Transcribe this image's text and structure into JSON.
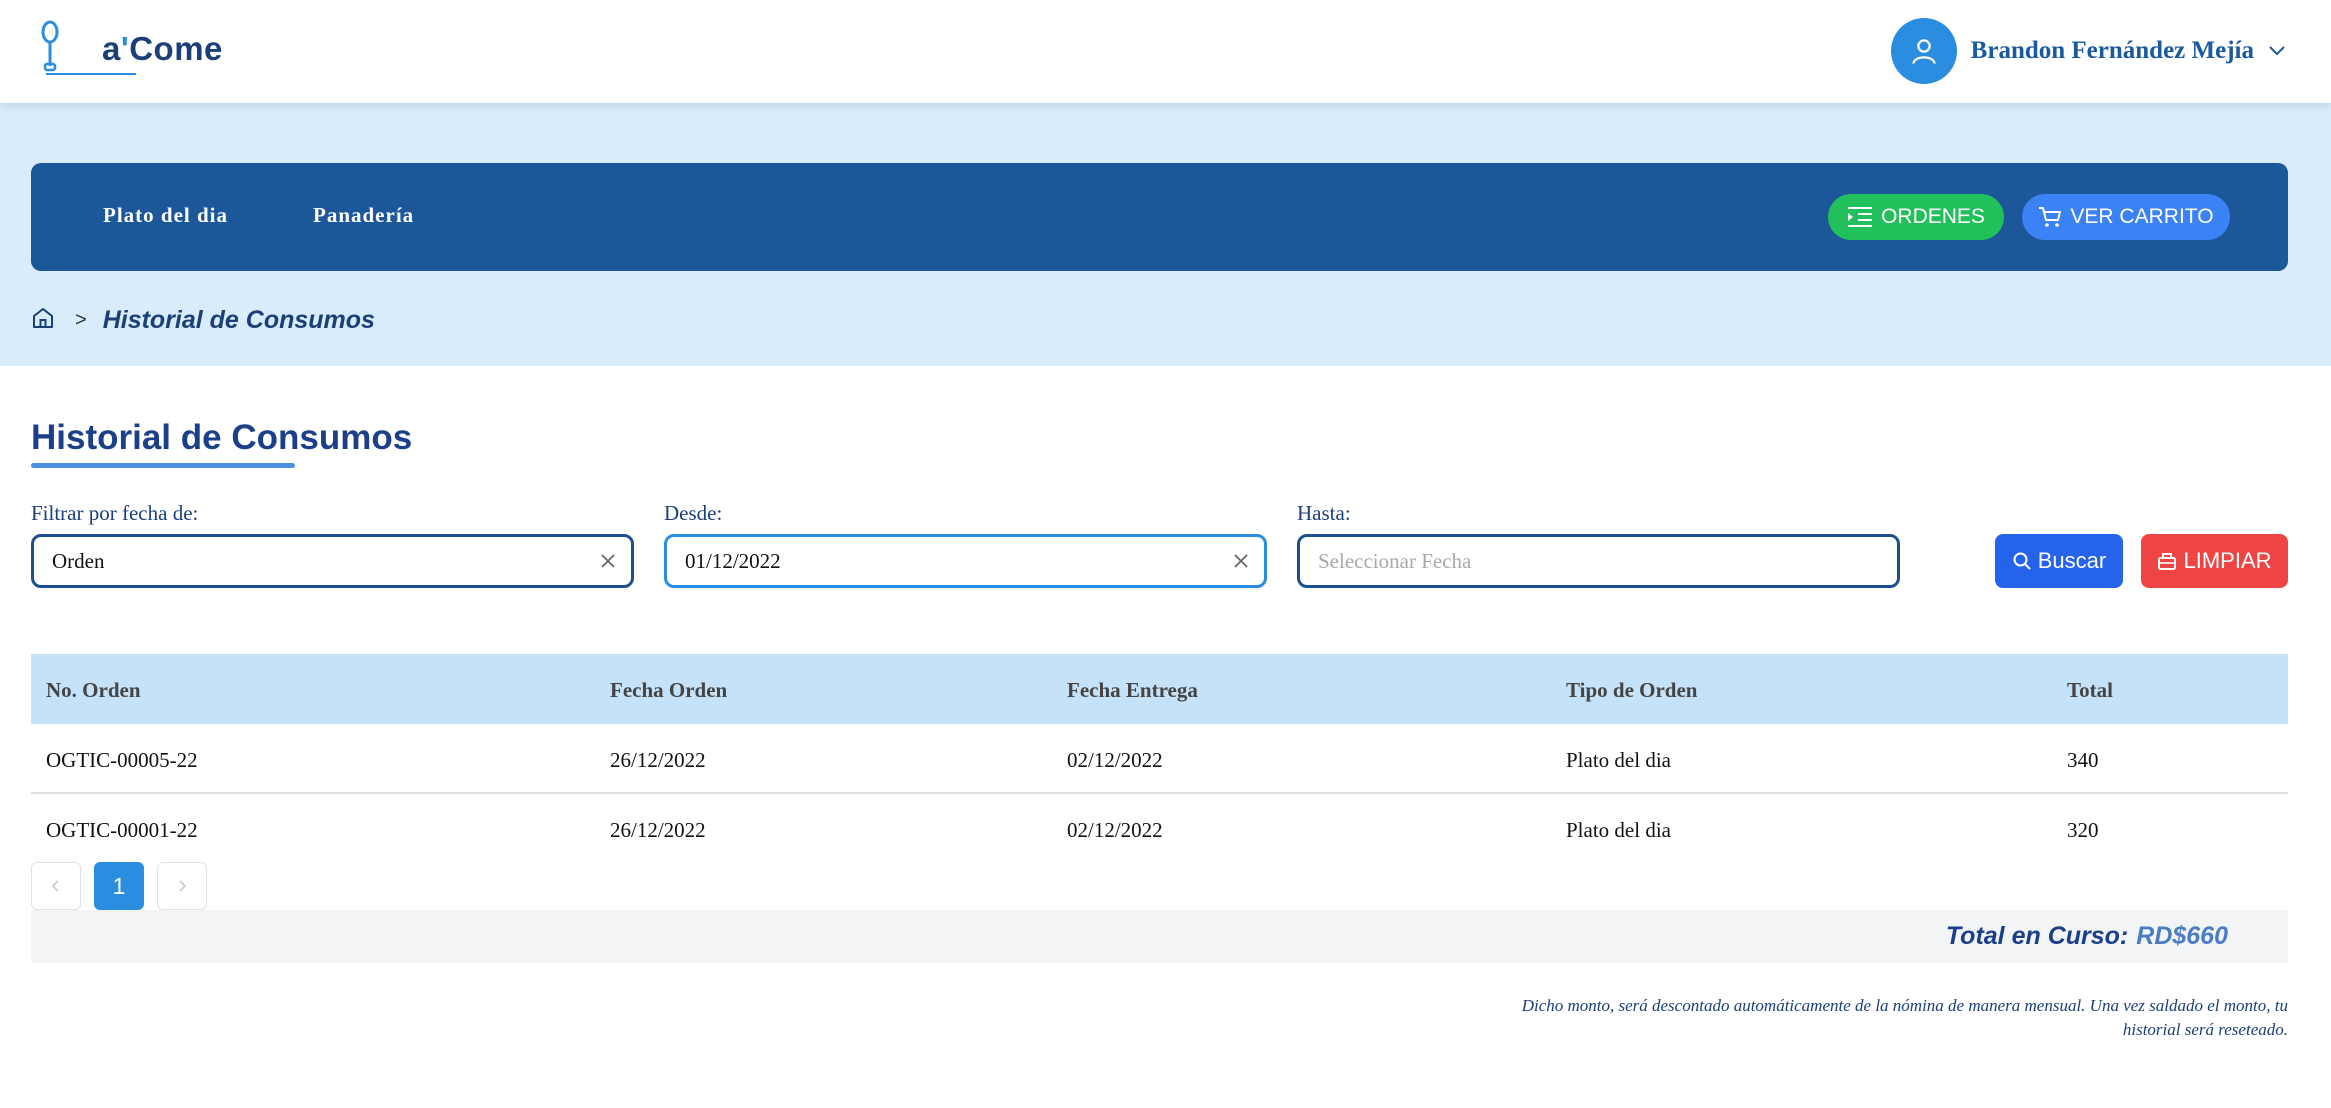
{
  "brand": {
    "logo_prefix": "a",
    "logo_apostrophe": "'",
    "logo_suffix": "Come",
    "logo_icon": "spoon-logo-icon",
    "accent": "#2a8de0",
    "navy": "#1b5799"
  },
  "header": {
    "user_name": "Brandon Fernández Mejía",
    "avatar_icon": "user-icon",
    "menu_icon": "chevron-down-icon"
  },
  "nav": {
    "links": [
      "Plato del dia",
      "Panadería"
    ],
    "ordenes_label": "ORDENES",
    "carrito_label": "VER CARRITO"
  },
  "breadcrumb": {
    "home_icon": "home-icon",
    "separator": ">",
    "current": "Historial de Consumos"
  },
  "main": {
    "title": "Historial de Consumos",
    "filters": {
      "tipo_label": "Filtrar por fecha de:",
      "tipo_value": "Orden",
      "desde_label": "Desde:",
      "desde_value": "01/12/2022",
      "hasta_label": "Hasta:",
      "hasta_placeholder": "Seleccionar Fecha"
    },
    "buscar_label": "Buscar",
    "limpiar_label": "LIMPIAR"
  },
  "table": {
    "columns": [
      "No. Orden",
      "Fecha Orden",
      "Fecha Entrega",
      "Tipo de Orden",
      "Total"
    ],
    "rows": [
      [
        "OGTIC-00005-22",
        "26/12/2022",
        "02/12/2022",
        "Plato del dia",
        "340"
      ],
      [
        "OGTIC-00001-22",
        "26/12/2022",
        "02/12/2022",
        "Plato del dia",
        "320"
      ]
    ]
  },
  "pagination": {
    "current_page": "1",
    "prev_icon": "chevron-left-icon",
    "next_icon": "chevron-right-icon"
  },
  "summary": {
    "total_label": "Total en Curso:",
    "total_amount": "RD$660",
    "note": "Dicho monto, será descontado automáticamente de la nómina de manera mensual. Una vez saldado el monto, tu historial será reseteado."
  }
}
